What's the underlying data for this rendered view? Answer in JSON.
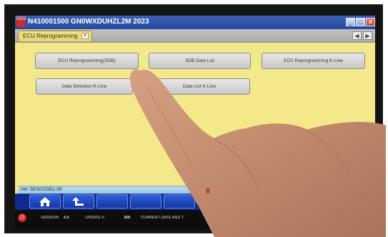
{
  "window": {
    "app_icon_label": "GDS",
    "title": "N410001500  GN0WXDUHZL2M 2023",
    "controls": {
      "minimize": "_",
      "maximize": "□",
      "close": "✕"
    }
  },
  "tabs": [
    {
      "label": "ECU Reprogramming",
      "close": "✕"
    }
  ],
  "tab_nav": {
    "prev": "◀",
    "next": "▶"
  },
  "functions": {
    "row1": [
      "ECU Reprogramming(SDB)",
      "SDB Data List",
      "ECU Reprogramming K-Line"
    ],
    "row2": [
      "Data Selection K-Line",
      "Data List K-Line"
    ]
  },
  "version_text": "Ver SEW22061-00",
  "status": {
    "version_label": "VERSION:",
    "version_value": "4.0",
    "update_label": "UPDATE #:",
    "update_value": "368",
    "datetime_label": "CURRENT DATE AND T"
  },
  "icons": {
    "home": "home-icon",
    "back": "back-arrow-icon",
    "power": "power-icon"
  },
  "colors": {
    "content_bg": "#f3e98a",
    "titlebar": "#2c4fa4",
    "toolbar": "#0f2c8c",
    "tab_active": "#f0dc78"
  }
}
